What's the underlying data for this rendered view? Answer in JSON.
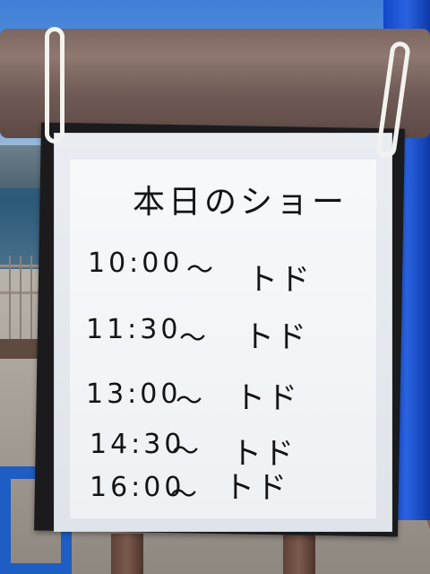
{
  "sign": {
    "title": "本日のショー",
    "rows": [
      {
        "time": "10:00",
        "tilde": "〜",
        "act": "トド"
      },
      {
        "time": "11:30",
        "tilde": "〜",
        "act": "トド"
      },
      {
        "time": "13:00",
        "tilde": "〜",
        "act": "トド"
      },
      {
        "time": "14:30",
        "tilde": "〜",
        "act": "トド"
      },
      {
        "time": "16:00",
        "tilde": "〜",
        "act": "トド"
      }
    ]
  }
}
